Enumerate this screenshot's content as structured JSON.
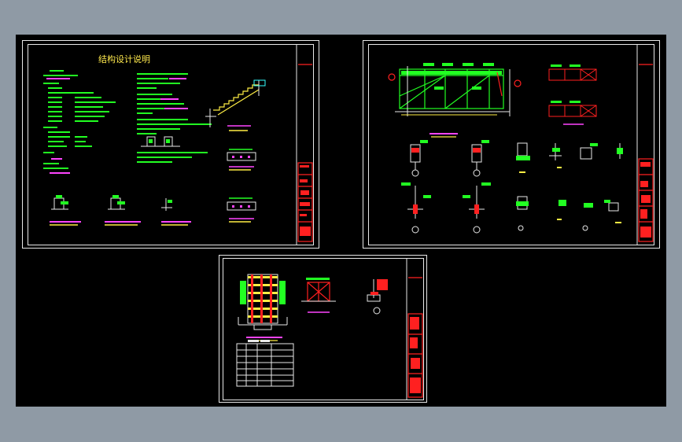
{
  "app": {
    "background_color": "#8f9aa5",
    "viewport_color": "#000000"
  },
  "sheets": {
    "design_notes": {
      "title": "结构设计说明"
    },
    "frame_details": {},
    "foundation_details": {}
  },
  "colors": {
    "line_green": "#22ff22",
    "line_red": "#ff2020",
    "line_magenta": "#ff44ff",
    "line_yellow": "#ffee44",
    "line_cyan": "#33ffff",
    "line_white": "#e8e8e8"
  }
}
